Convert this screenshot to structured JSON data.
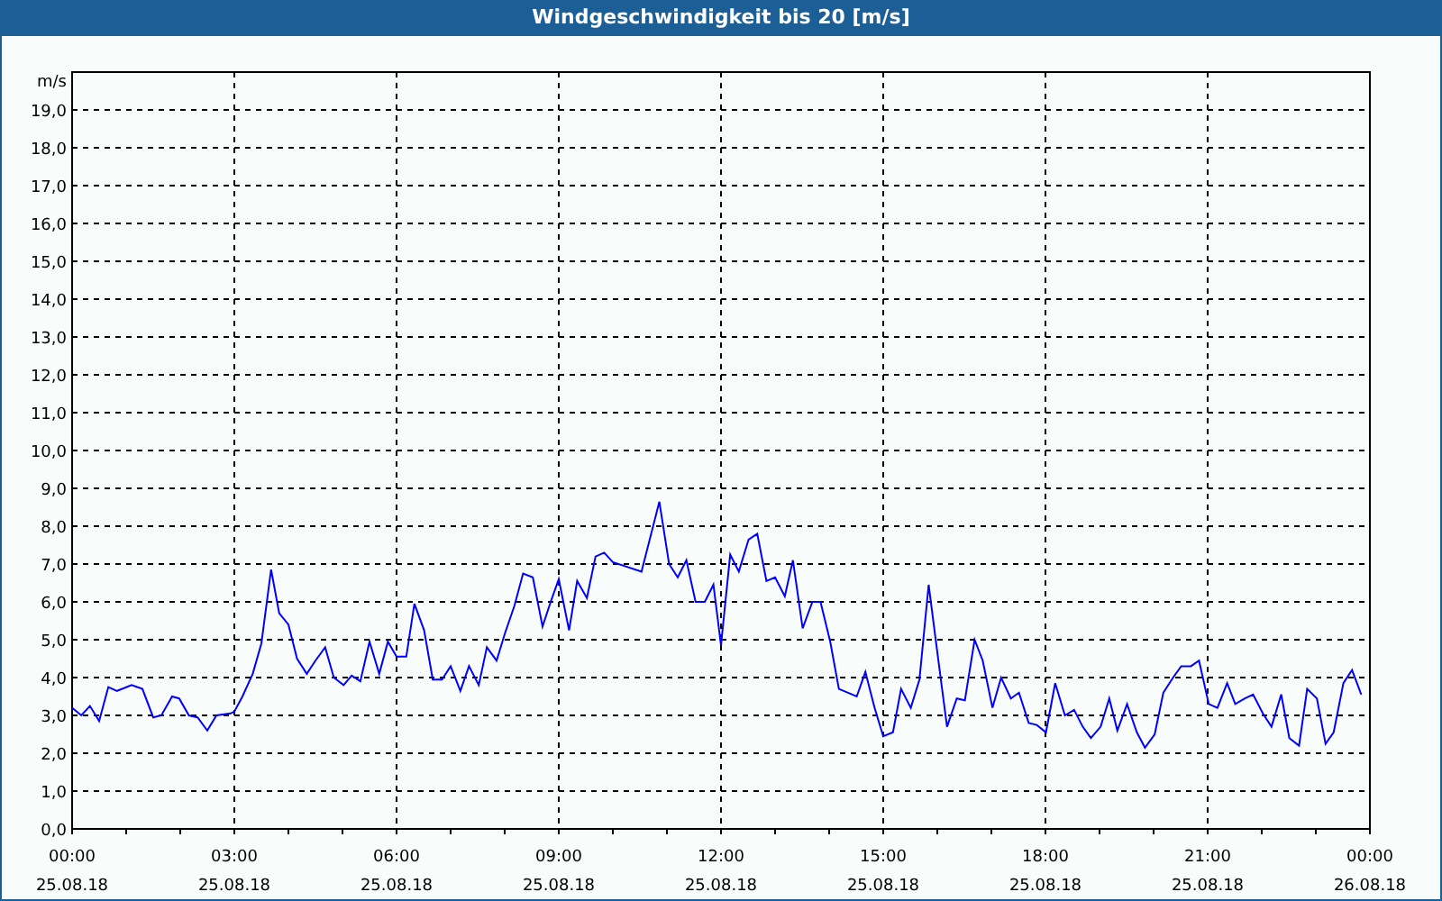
{
  "window": {
    "title": "Windgeschwindigkeit bis 20 [m/s]"
  },
  "x_axis_dates": [
    "25.08.18",
    "25.08.18",
    "25.08.18",
    "25.08.18",
    "25.08.18",
    "25.08.18",
    "25.08.18",
    "25.08.18",
    "26.08.18"
  ],
  "chart_data": {
    "type": "line",
    "ylabel": "m/s",
    "grid": true,
    "xlim": [
      0,
      24
    ],
    "ylim": [
      0,
      20
    ],
    "xticks": [
      {
        "value": 0,
        "label": "00:00"
      },
      {
        "value": 3,
        "label": "03:00"
      },
      {
        "value": 6,
        "label": "06:00"
      },
      {
        "value": 9,
        "label": "09:00"
      },
      {
        "value": 12,
        "label": "12:00"
      },
      {
        "value": 15,
        "label": "15:00"
      },
      {
        "value": 18,
        "label": "18:00"
      },
      {
        "value": 21,
        "label": "21:00"
      },
      {
        "value": 24,
        "label": "00:00"
      }
    ],
    "yticks": [
      {
        "value": 0,
        "label": "0,0"
      },
      {
        "value": 1,
        "label": "1,0"
      },
      {
        "value": 2,
        "label": "2,0"
      },
      {
        "value": 3,
        "label": "3,0"
      },
      {
        "value": 4,
        "label": "4,0"
      },
      {
        "value": 5,
        "label": "5,0"
      },
      {
        "value": 6,
        "label": "6,0"
      },
      {
        "value": 7,
        "label": "7,0"
      },
      {
        "value": 8,
        "label": "8,0"
      },
      {
        "value": 9,
        "label": "9,0"
      },
      {
        "value": 10,
        "label": "10,0"
      },
      {
        "value": 11,
        "label": "11,0"
      },
      {
        "value": 12,
        "label": "12,0"
      },
      {
        "value": 13,
        "label": "13,0"
      },
      {
        "value": 14,
        "label": "14,0"
      },
      {
        "value": 15,
        "label": "15,0"
      },
      {
        "value": 16,
        "label": "16,0"
      },
      {
        "value": 17,
        "label": "17,0"
      },
      {
        "value": 18,
        "label": "18,0"
      },
      {
        "value": 19,
        "label": "19,0"
      }
    ],
    "x": [
      0,
      0.17,
      0.33,
      0.5,
      0.67,
      0.83,
      1.1,
      1.3,
      1.5,
      1.65,
      1.85,
      1.98,
      2.16,
      2.32,
      2.5,
      2.67,
      2.93,
      3.0,
      3.15,
      3.34,
      3.5,
      3.68,
      3.83,
      4.0,
      4.16,
      4.34,
      4.5,
      4.68,
      4.84,
      5.02,
      5.17,
      5.33,
      5.5,
      5.68,
      5.84,
      6.0,
      6.18,
      6.33,
      6.51,
      6.67,
      6.84,
      7.0,
      7.18,
      7.34,
      7.52,
      7.67,
      7.85,
      8.0,
      8.18,
      8.34,
      8.52,
      8.7,
      8.85,
      9.0,
      9.19,
      9.34,
      9.52,
      9.68,
      9.84,
      10.0,
      10.53,
      10.86,
      11.04,
      11.2,
      11.36,
      11.53,
      11.7,
      11.86,
      12.0,
      12.17,
      12.33,
      12.51,
      12.67,
      12.84,
      13.0,
      13.18,
      13.33,
      13.51,
      13.69,
      13.84,
      14.02,
      14.18,
      14.51,
      14.67,
      14.84,
      15.0,
      15.18,
      15.33,
      15.51,
      15.67,
      15.84,
      16.02,
      16.18,
      16.36,
      16.51,
      16.69,
      16.84,
      17.02,
      17.18,
      17.36,
      17.51,
      17.69,
      17.84,
      18.01,
      18.18,
      18.36,
      18.53,
      18.69,
      18.84,
      19.02,
      19.18,
      19.33,
      19.51,
      19.69,
      19.84,
      20.02,
      20.18,
      20.36,
      20.51,
      20.69,
      20.84,
      21.02,
      21.18,
      21.36,
      21.51,
      21.69,
      21.84,
      22.02,
      22.18,
      22.36,
      22.51,
      22.69,
      22.84,
      23.02,
      23.18,
      23.33,
      23.51,
      23.67,
      23.84
    ],
    "series": [
      {
        "color": "#0000ff",
        "values": [
          3.2,
          3.0,
          3.25,
          2.85,
          3.75,
          3.65,
          3.8,
          3.7,
          2.95,
          3.0,
          3.5,
          3.45,
          3.0,
          2.95,
          2.6,
          3.0,
          3.05,
          3.1,
          3.5,
          4.1,
          4.9,
          6.85,
          5.7,
          5.4,
          4.5,
          4.1,
          4.45,
          4.8,
          4.0,
          3.8,
          4.05,
          3.9,
          4.95,
          4.1,
          4.95,
          4.55,
          4.55,
          5.95,
          5.25,
          3.95,
          3.95,
          4.3,
          3.65,
          4.3,
          3.8,
          4.8,
          4.45,
          5.15,
          5.9,
          6.75,
          6.65,
          5.35,
          6.0,
          6.6,
          5.25,
          6.55,
          6.1,
          7.2,
          7.3,
          7.05,
          6.8,
          8.65,
          7.0,
          6.65,
          7.1,
          6.0,
          6.0,
          6.45,
          4.85,
          7.25,
          6.8,
          7.65,
          7.8,
          6.55,
          6.65,
          6.15,
          7.1,
          5.3,
          6.0,
          6.0,
          4.95,
          3.7,
          3.5,
          4.15,
          3.2,
          2.45,
          2.55,
          3.7,
          3.2,
          3.95,
          6.45,
          4.45,
          2.7,
          3.45,
          3.4,
          5.0,
          4.45,
          3.2,
          4.0,
          3.45,
          3.6,
          2.8,
          2.75,
          2.55,
          3.85,
          3.0,
          3.15,
          2.7,
          2.4,
          2.7,
          3.45,
          2.6,
          3.3,
          2.55,
          2.15,
          2.5,
          3.6,
          4.0,
          4.3,
          4.3,
          4.45,
          3.3,
          3.2,
          3.85,
          3.3,
          3.45,
          3.55,
          3.05,
          2.7,
          3.55,
          2.4,
          2.2,
          3.7,
          3.45,
          2.25,
          2.55,
          3.85,
          4.2,
          3.55
        ]
      }
    ]
  }
}
